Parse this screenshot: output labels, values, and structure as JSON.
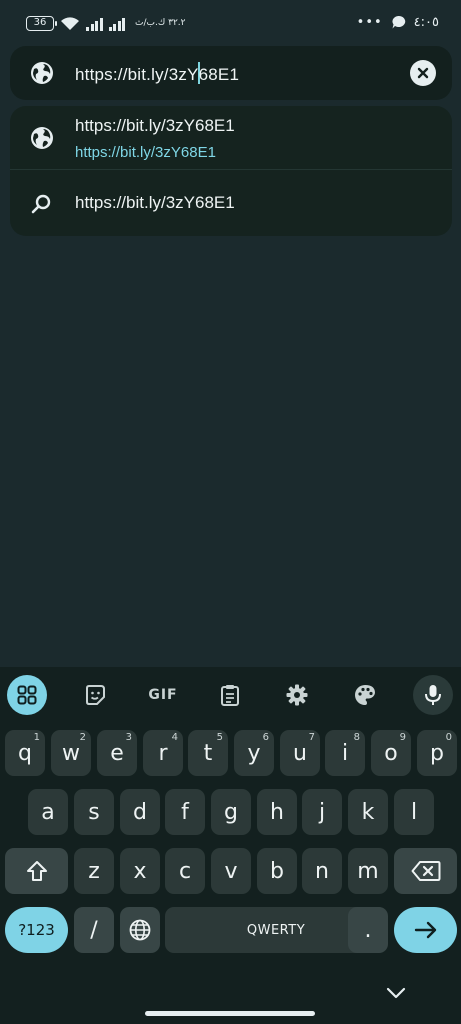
{
  "status_bar": {
    "battery": "36",
    "speed": "٣٢.٢ ك.ب/ث",
    "dots": "•••",
    "time": "٤:٠٥"
  },
  "address_bar": {
    "url_before_caret": "https://bit.ly/3zY",
    "url_after_caret": "68E1",
    "icon": "globe-icon",
    "clear_icon": "close-circle-icon"
  },
  "suggestions": [
    {
      "icon": "globe-icon",
      "title": "https://bit.ly/3zY68E1",
      "url": "https://bit.ly/3zY68E1"
    },
    {
      "icon": "search-icon",
      "title": "https://bit.ly/3zY68E1"
    }
  ],
  "keyboard": {
    "toolbar": {
      "apps_icon": "grid-icon",
      "sticker_icon": "sticker-icon",
      "gif": "GIF",
      "clipboard_icon": "clipboard-icon",
      "settings_icon": "gear-icon",
      "theme_icon": "palette-icon",
      "mic_icon": "mic-icon"
    },
    "row1": [
      {
        "k": "q",
        "h": "1"
      },
      {
        "k": "w",
        "h": "2"
      },
      {
        "k": "e",
        "h": "3"
      },
      {
        "k": "r",
        "h": "4"
      },
      {
        "k": "t",
        "h": "5"
      },
      {
        "k": "y",
        "h": "6"
      },
      {
        "k": "u",
        "h": "7"
      },
      {
        "k": "i",
        "h": "8"
      },
      {
        "k": "o",
        "h": "9"
      },
      {
        "k": "p",
        "h": "0"
      }
    ],
    "row2": [
      "a",
      "s",
      "d",
      "f",
      "g",
      "h",
      "j",
      "k",
      "l"
    ],
    "row3": [
      "z",
      "x",
      "c",
      "v",
      "b",
      "n",
      "m"
    ],
    "symbols_label": "?123",
    "slash": "/",
    "space_label": "QWERTY",
    "period": ".",
    "colors": {
      "accent": "#7fd3e6",
      "key": "#2c3938",
      "background": "#1b2a2d"
    }
  }
}
